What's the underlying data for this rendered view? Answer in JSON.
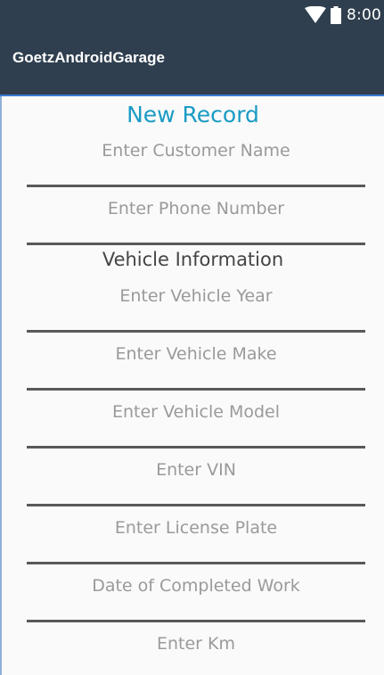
{
  "status_bar": {
    "time": "8:00",
    "icons": [
      "wifi-icon",
      "battery-icon"
    ]
  },
  "app_bar": {
    "title": "GoetzAndroidGarage"
  },
  "form": {
    "title": "New Record",
    "customer_fields": [
      {
        "placeholder": "Enter Customer Name"
      },
      {
        "placeholder": "Enter Phone Number"
      }
    ],
    "vehicle_section_title": "Vehicle Information",
    "vehicle_fields": [
      {
        "placeholder": "Enter Vehicle Year"
      },
      {
        "placeholder": "Enter Vehicle Make"
      },
      {
        "placeholder": "Enter Vehicle Model"
      },
      {
        "placeholder": "Enter VIN"
      },
      {
        "placeholder": "Enter License Plate"
      },
      {
        "placeholder": "Date of Completed Work"
      },
      {
        "placeholder": "Enter Km"
      }
    ]
  },
  "colors": {
    "app_bar": "#2f3f4f",
    "form_title": "#1a9bc4",
    "underline": "#595959",
    "placeholder": "#9a9a9a"
  }
}
